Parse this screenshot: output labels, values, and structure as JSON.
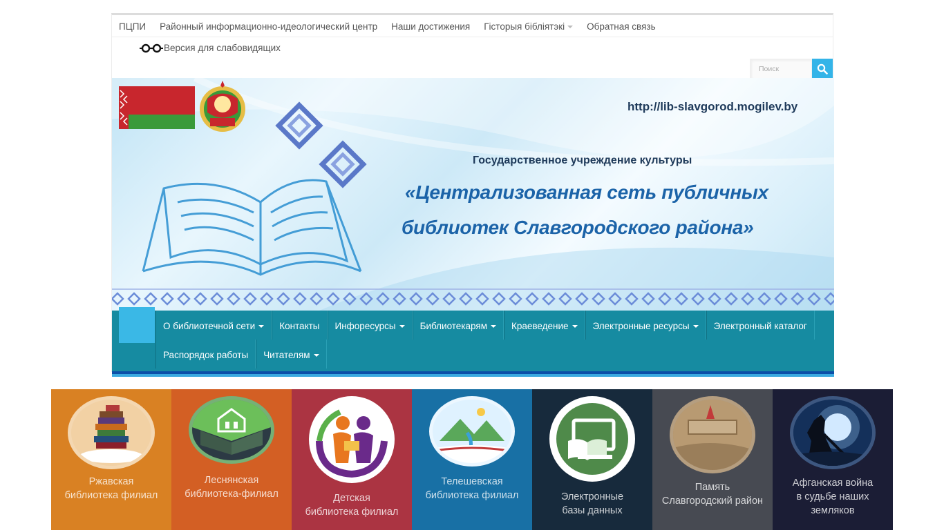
{
  "topnav": {
    "items": [
      {
        "label": "ПЦПИ"
      },
      {
        "label": "Районный информационно-идеологический центр"
      },
      {
        "label": "Наши достижения"
      },
      {
        "label": "Гісторыя бібліятэкі",
        "caret": true
      },
      {
        "label": "Обратная связь"
      }
    ]
  },
  "low_vision": {
    "label": "Версия для слабовидящих",
    "icon": "glasses-icon"
  },
  "search": {
    "placeholder": "Поиск",
    "icon": "search-icon"
  },
  "banner": {
    "url": "http://lib-slavgorod.mogilev.by",
    "org": "Государственное учреждение культуры",
    "name_line1": "«Централизованная сеть публичных",
    "name_line2": "библиотек Славгородского района»"
  },
  "mainnav": {
    "row1": [
      {
        "label": "О библиотечной сети",
        "caret": true
      },
      {
        "label": "Контакты"
      },
      {
        "label": "Инфоресурсы",
        "caret": true
      },
      {
        "label": "Библиотекарям",
        "caret": true
      },
      {
        "label": "Краеведение",
        "caret": true
      },
      {
        "label": "Электронные ресурсы",
        "caret": true
      },
      {
        "label": "Электронный каталог"
      }
    ],
    "row2": [
      {
        "label": "Распорядок работы"
      },
      {
        "label": "Читателям",
        "caret": true
      }
    ]
  },
  "tiles": [
    {
      "line1": "Ржавская",
      "line2": "библиотека филиал",
      "bg": "#d98123",
      "icon": "books-stack-icon"
    },
    {
      "line1": "Леснянская",
      "line2": "библиотека-филиал",
      "bg": "#d35f24",
      "icon": "library-building-icon"
    },
    {
      "line1": "Детская",
      "line2": "библиотека филиал",
      "bg": "#ab3442",
      "icon": "children-reading-icon"
    },
    {
      "line1": "Телешевская",
      "line2": "библиотека филиал",
      "bg": "#1870a5",
      "icon": "open-book-landscape-icon"
    },
    {
      "line1": "Электронные",
      "line2": "базы данных",
      "bg": "#172a3c",
      "icon": "ebook-monitor-icon"
    },
    {
      "line1": "Память",
      "line2": "Славгородский район",
      "bg": "#474a52",
      "icon": "memory-monument-icon"
    },
    {
      "line1": "Афганская война",
      "line2": "в судьбе наших",
      "line3": "земляков",
      "bg": "#1b1d35",
      "icon": "soldier-silhouette-icon"
    }
  ]
}
